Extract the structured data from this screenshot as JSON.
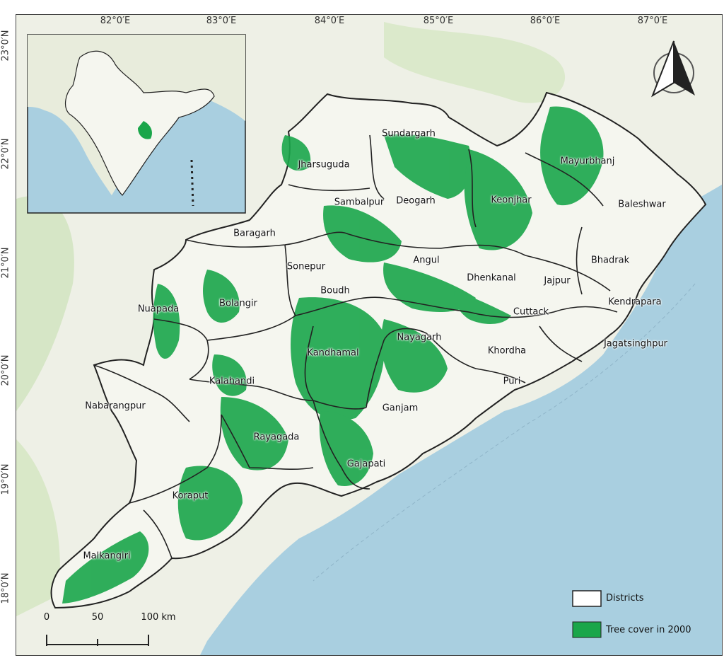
{
  "axes": {
    "longitude_ticks": [
      "82°0′E",
      "83°0′E",
      "84°0′E",
      "85°0′E",
      "86°0′E",
      "87°0′E"
    ],
    "latitude_ticks": [
      "23°0′N",
      "22°0′N",
      "21°0′N",
      "20°0′N",
      "19°0′N",
      "18°0′N"
    ]
  },
  "districts": [
    "Sundargarh",
    "Jharsuguda",
    "Mayurbhanj",
    "Sambalpur",
    "Deogarh",
    "Keonjhar",
    "Baleshwar",
    "Baragarh",
    "Angul",
    "Bhadrak",
    "Sonepur",
    "Dhenkanal",
    "Jajpur",
    "Boudh",
    "Kendrapara",
    "Nuapada",
    "Bolangir",
    "Cuttack",
    "Nayagarh",
    "Jagatsinghpur",
    "Khordha",
    "Kandhamal",
    "Kalahandi",
    "Puri",
    "Nabarangpur",
    "Ganjam",
    "Rayagada",
    "Gajapati",
    "Koraput",
    "Malkangiri"
  ],
  "legend": {
    "districts_label": "Districts",
    "tree_cover_label": "Tree cover in 2000"
  },
  "scale_bar": {
    "labels": [
      "0",
      "50",
      "100 km"
    ]
  },
  "colors": {
    "sea": "#a9cfe0",
    "land": "#eef0e6",
    "forest_background": "#cfe3bd",
    "tree_cover": "#1aa64a",
    "district_border": "#222222"
  },
  "icons": {
    "north_arrow": "north-arrow-icon"
  }
}
